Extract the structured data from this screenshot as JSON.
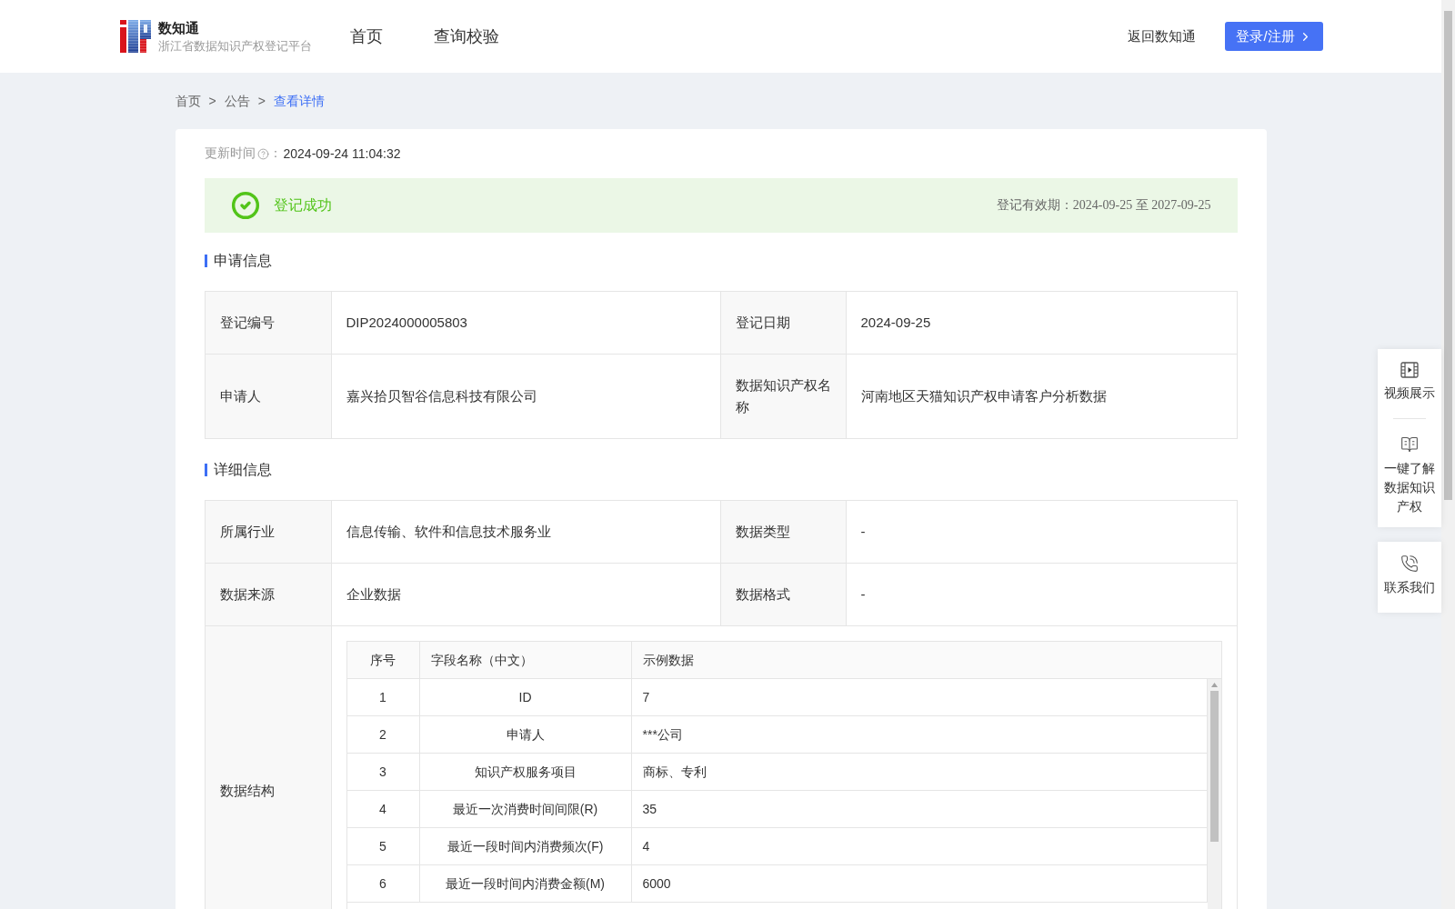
{
  "header": {
    "logo": {
      "title": "数知通",
      "subtitle": "浙江省数据知识产权登记平台"
    },
    "nav": [
      {
        "label": "首页",
        "selected": false
      },
      {
        "label": "查询校验",
        "selected": false
      }
    ],
    "back_link": "返回数知通",
    "login_button": "登录/注册"
  },
  "breadcrumb": {
    "items": [
      {
        "label": "首页",
        "current": false
      },
      {
        "separator": ">",
        "label": "公告",
        "current": false
      },
      {
        "separator": ">",
        "label": "查看详情",
        "current": true
      }
    ]
  },
  "update_time": {
    "label": "更新时间",
    "colon": "：",
    "value": "2024-09-24 11:04:32"
  },
  "status_banner": {
    "kind": "success",
    "text": "登记成功",
    "validity_label": "登记有效期：",
    "validity": "2024-09-25 至 2027-09-25"
  },
  "sections": [
    {
      "title": "申请信息",
      "rows": [
        [
          {
            "label": "登记编号",
            "value": "DIP2024000005803"
          },
          {
            "label": "登记日期",
            "value": "2024-09-25"
          }
        ],
        [
          {
            "label": "申请人",
            "value": "嘉兴拾贝智谷信息科技有限公司"
          },
          {
            "label": "数据知识产权名称",
            "value": "河南地区天猫知识产权申请客户分析数据"
          }
        ]
      ]
    },
    {
      "title": "详细信息",
      "rows": [
        [
          {
            "label": "所属行业",
            "value": "信息传输、软件和信息技术服务业"
          },
          {
            "label": "数据类型",
            "value": "-"
          }
        ],
        [
          {
            "label": "数据来源",
            "value": "企业数据"
          },
          {
            "label": "数据格式",
            "value": "-"
          }
        ]
      ],
      "structure": {
        "label": "数据结构",
        "columns": [
          "序号",
          "字段名称（中文）",
          "示例数据"
        ],
        "rows": [
          [
            "1",
            "ID",
            "7"
          ],
          [
            "2",
            "申请人",
            "***公司"
          ],
          [
            "3",
            "知识产权服务项目",
            "商标、专利"
          ],
          [
            "4",
            "最近一次消费时间间限(R)",
            "35"
          ],
          [
            "5",
            "最近一段时间内消费频次(F)",
            "4"
          ],
          [
            "6",
            "最近一段时间内消费金额(M)",
            "6000"
          ]
        ]
      }
    }
  ],
  "side_panel": {
    "groups": [
      [
        {
          "kind": "video",
          "label": "视频展示"
        },
        {
          "kind": "book",
          "label": "一键了解数据知识产权"
        }
      ],
      [
        {
          "kind": "phone",
          "label": "联系我们"
        }
      ]
    ]
  }
}
